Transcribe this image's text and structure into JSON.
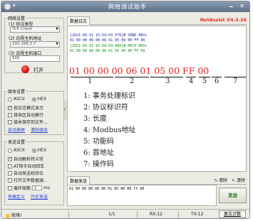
{
  "window": {
    "title": "网络调试助手",
    "min_btn": "🗕",
    "max_btn": "🗖",
    "close_btn": "✕"
  },
  "net_settings": {
    "legend": "网络设置",
    "protocol_label": "(1) 协议类型",
    "protocol_value": "TCP Client",
    "host_label": "(2) 远程主机地址",
    "host_value": "192.168.3.7",
    "port_label": "(3) 远程主机端口",
    "port_value": "502",
    "open_label": "打开"
  },
  "recv_settings": {
    "legend": "接收设置",
    "ascii": "ASCII",
    "hex": "HEX",
    "opt1": "按日志模式显示",
    "opt2": "接收区自动换行",
    "opt3": "接收保存到文件...",
    "link_save": "自动滚屏",
    "link_clear": "清除接收"
  },
  "send_settings": {
    "legend": "发送设置",
    "ascii": "ASCII",
    "hex": "HEX",
    "opt1": "自动解析转义符",
    "opt2": "AT指令自动回车",
    "opt3": "自动发送校验位",
    "opt4": "打开文件数据源...",
    "opt5": "循环周期",
    "period_value": "1",
    "period_unit": "ms",
    "link_shortcut": "快捷定义",
    "link_history": "历史发送"
  },
  "receive": {
    "tab": "数据日志",
    "brand": "NetAssist V4.3.26",
    "log": [
      "[2021-05-31 15:54:03.576]# SEND HEX>",
      "01 00 00 00 00 06 01 05 00 00 FF 00",
      "[2021-05-31 15:54:03.609]# RECV HEX>",
      "01 00 00 00 00 06 01 05 00 00 FF 00"
    ],
    "hex_big": "01 00 00 00 06 01 05 00 FF 00",
    "indices": [
      "1",
      "2",
      "3",
      "4",
      "5",
      "6",
      "7"
    ],
    "legend_items": [
      "1:  事务处理标识",
      "2:  协议标识符",
      "3:  长度",
      "4:  Modbus地址",
      "5:  功能码",
      "6:  首地址",
      "7:  操作码"
    ]
  },
  "send": {
    "tab": "数据发送",
    "clear_label": "清除",
    "clear_all_label": "清除",
    "content": "01 00 00 00 00 06 01 05 00 00 ff 00",
    "send_label": "发送"
  },
  "status": {
    "ready": "就绪!",
    "page": "1/1",
    "rx": "RX:12",
    "tx": "TX:12",
    "reset": "复位计数"
  },
  "colors": {
    "accent": "#e0301e",
    "log_send": "#1a1aa0",
    "log_recv": "#0a8a0a",
    "hex_big": "#e02020"
  }
}
